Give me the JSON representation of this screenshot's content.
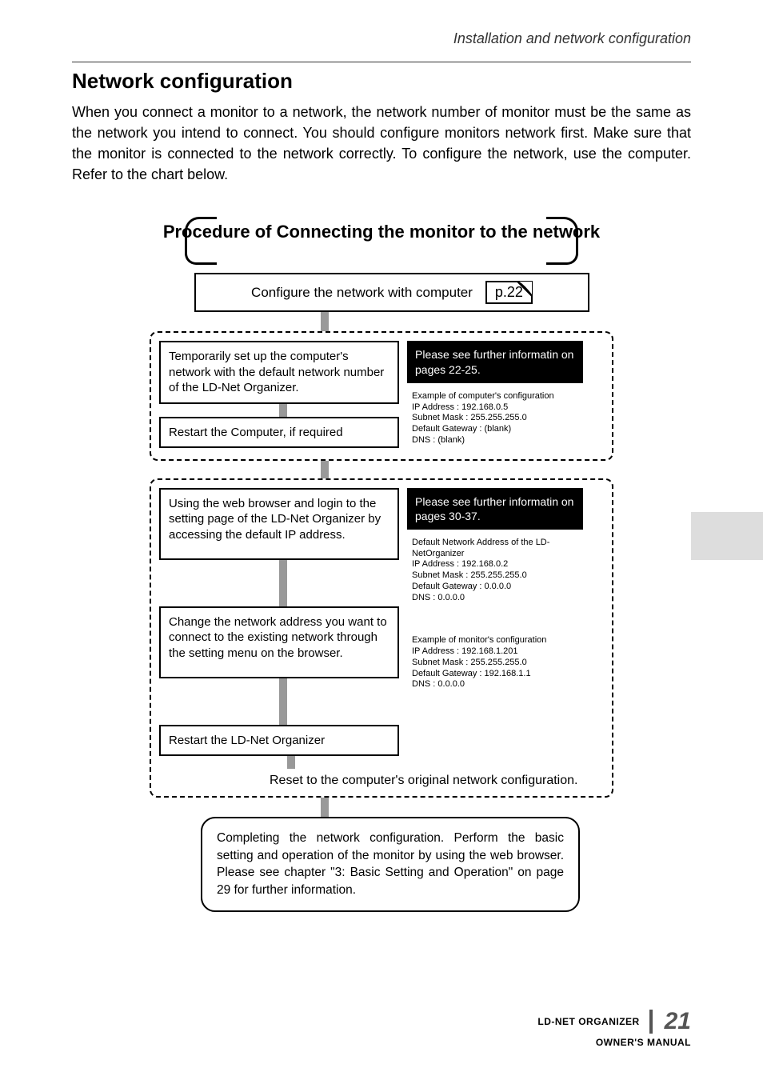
{
  "header": {
    "breadcrumb": "Installation and network configuration"
  },
  "title": "Network configuration",
  "intro": "When you connect a monitor to a network, the network number of monitor must be the same as the network you intend to connect. You should configure monitors network first. Make sure that the monitor is connected to the network correctly. To configure the network, use the computer. Refer to the chart below.",
  "procedure": {
    "title": "Procedure of Connecting the monitor to the network",
    "top": {
      "text": "Configure the network with computer",
      "page_ref": "p.22"
    },
    "group1": {
      "step1": "Temporarily set up the computer's network with the default network number of the LD-Net Organizer.",
      "step2": "Restart the Computer, if required",
      "note_title": "Please see further informatin on pages 22-25.",
      "example_label": "Example of computer's configuration",
      "example_lines": "IP Address : 192.168.0.5\nSubnet Mask : 255.255.255.0\nDefault Gateway : (blank)\nDNS : (blank)"
    },
    "group2": {
      "step1": "Using the web browser and login to the setting page of the LD-Net Organizer by accessing the default IP address.",
      "step2": "Change the network address you want to connect to the existing network through the setting menu on the browser.",
      "step3": "Restart the LD-Net Organizer",
      "note_title": "Please see further informatin on pages 30-37.",
      "default_label": "Default Network Address of the LD-NetOrganizer",
      "default_lines": "IP Address : 192.168.0.2\nSubnet Mask : 255.255.255.0\nDefault Gateway : 0.0.0.0\nDNS : 0.0.0.0",
      "example_label": "Example of monitor's configuration",
      "example_lines": "IP Address : 192.168.1.201\nSubnet Mask : 255.255.255.0\nDefault Gateway : 192.168.1.1\nDNS : 0.0.0.0",
      "reset": "Reset to the computer's original network configuration."
    },
    "final": "Completing the network configuration. Perform the basic setting and operation of the monitor by using the web browser. Please see chapter \"3: Basic Setting and Operation\" on page 29 for further information."
  },
  "footer": {
    "product": "LD-NET ORGANIZER",
    "page": "21",
    "sub": "OWNER'S MANUAL"
  }
}
